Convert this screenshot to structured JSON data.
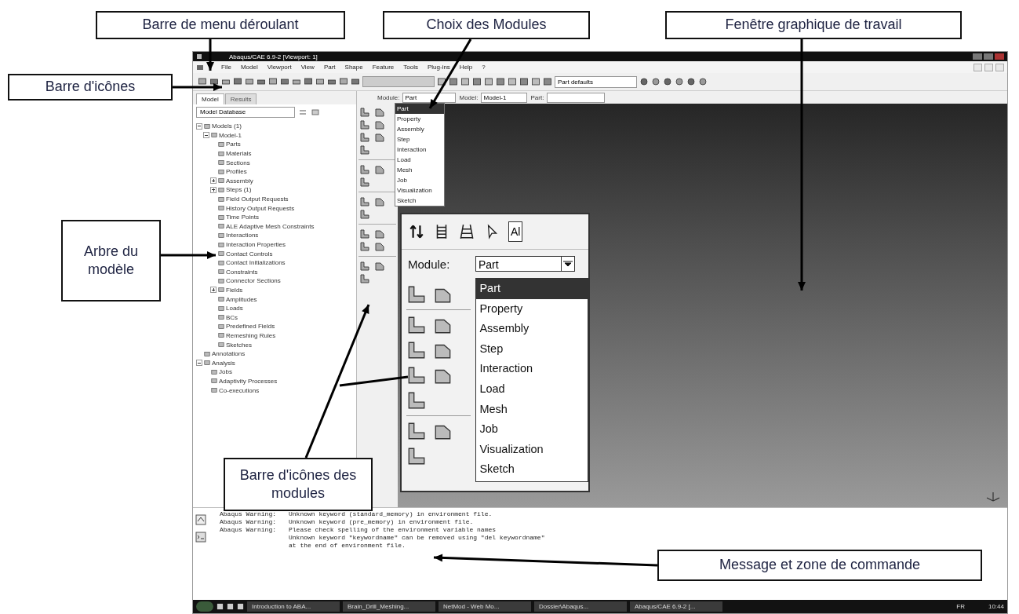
{
  "annotations": [
    {
      "text": "Barre de menu déroulant"
    },
    {
      "text": "Choix des Modules"
    },
    {
      "text": "Fenêtre graphique de travail"
    },
    {
      "text": "Barre d'icônes"
    },
    {
      "text": "Arbre du modèle"
    },
    {
      "text": "Barre d'icônes des modules"
    },
    {
      "text": "Message et zone de commande"
    }
  ],
  "window": {
    "title": "Abaqus/CAE 6.9-2 [Viewport: 1]"
  },
  "menu_bar": [
    "File",
    "Model",
    "Viewport",
    "View",
    "Part",
    "Shape",
    "Feature",
    "Tools",
    "Plug-ins",
    "Help",
    "?"
  ],
  "toolbar": {
    "render_style": "Part defaults"
  },
  "model_tree": {
    "tabs": [
      {
        "label": "Model",
        "selected": true
      },
      {
        "label": "Results",
        "selected": false
      }
    ],
    "source": "Model Database",
    "items": [
      {
        "label": "Models (1)",
        "expanded": true,
        "children": [
          {
            "label": "Model-1",
            "expanded": true,
            "children": [
              {
                "label": "Parts"
              },
              {
                "label": "Materials"
              },
              {
                "label": "Sections"
              },
              {
                "label": "Profiles"
              },
              {
                "label": "Assembly",
                "expanded": false
              },
              {
                "label": "Steps (1)",
                "expanded": false
              },
              {
                "label": "Field Output Requests"
              },
              {
                "label": "History Output Requests"
              },
              {
                "label": "Time Points"
              },
              {
                "label": "ALE Adaptive Mesh Constraints"
              },
              {
                "label": "Interactions"
              },
              {
                "label": "Interaction Properties"
              },
              {
                "label": "Contact Controls"
              },
              {
                "label": "Contact Initializations"
              },
              {
                "label": "Constraints"
              },
              {
                "label": "Connector Sections"
              },
              {
                "label": "Fields",
                "expanded": false
              },
              {
                "label": "Amplitudes"
              },
              {
                "label": "Loads"
              },
              {
                "label": "BCs"
              },
              {
                "label": "Predefined Fields"
              },
              {
                "label": "Remeshing Rules"
              },
              {
                "label": "Sketches"
              }
            ]
          }
        ]
      },
      {
        "label": "Annotations"
      },
      {
        "label": "Analysis",
        "expanded": true,
        "children": [
          {
            "label": "Jobs"
          },
          {
            "label": "Adaptivity Processes"
          },
          {
            "label": "Co-executions"
          }
        ]
      }
    ]
  },
  "context_bar": {
    "module_label": "Module:",
    "module": "Part",
    "model_label": "Model:",
    "model": "Model-1",
    "part_label": "Part:"
  },
  "module_list": [
    {
      "label": "Part",
      "selected": true
    },
    {
      "label": "Property",
      "selected": false
    },
    {
      "label": "Assembly",
      "selected": false
    },
    {
      "label": "Step",
      "selected": false
    },
    {
      "label": "Interaction",
      "selected": false
    },
    {
      "label": "Load",
      "selected": false
    },
    {
      "label": "Mesh",
      "selected": false
    },
    {
      "label": "Job",
      "selected": false
    },
    {
      "label": "Visualization",
      "selected": false
    },
    {
      "label": "Sketch",
      "selected": false
    }
  ],
  "inset": {
    "toolbar_text": "Al",
    "module_label": "Module:",
    "module": "Part",
    "module_list": [
      {
        "label": "Part",
        "selected": true
      },
      {
        "label": "Property",
        "selected": false
      },
      {
        "label": "Assembly",
        "selected": false
      },
      {
        "label": "Step",
        "selected": false
      },
      {
        "label": "Interaction",
        "selected": false
      },
      {
        "label": "Load",
        "selected": false
      },
      {
        "label": "Mesh",
        "selected": false
      },
      {
        "label": "Job",
        "selected": false
      },
      {
        "label": "Visualization",
        "selected": false
      },
      {
        "label": "Sketch",
        "selected": false
      }
    ]
  },
  "messages": [
    {
      "source": "Abaqus Warning:",
      "text": "Unknown keyword (standard_memory) in environment file."
    },
    {
      "source": "Abaqus Warning:",
      "text": "Unknown keyword (pre_memory) in environment file."
    },
    {
      "source": "Abaqus Warning:",
      "text": "Please check spelling of the environment variable names"
    },
    {
      "text": "Unknown keyword \"keywordname\" can be removed using \"del keywordname\""
    },
    {
      "text": "at the end of environment file."
    }
  ],
  "taskbar": {
    "items": [
      "Introduction to ABA...",
      "Brain_Drill_Meshing...",
      "NetMod - Web Mo...",
      "Dossier\\Abaqus...",
      "Abaqus/CAE 6.9-2 [..."
    ],
    "language": "FR",
    "clock": "10:44"
  }
}
